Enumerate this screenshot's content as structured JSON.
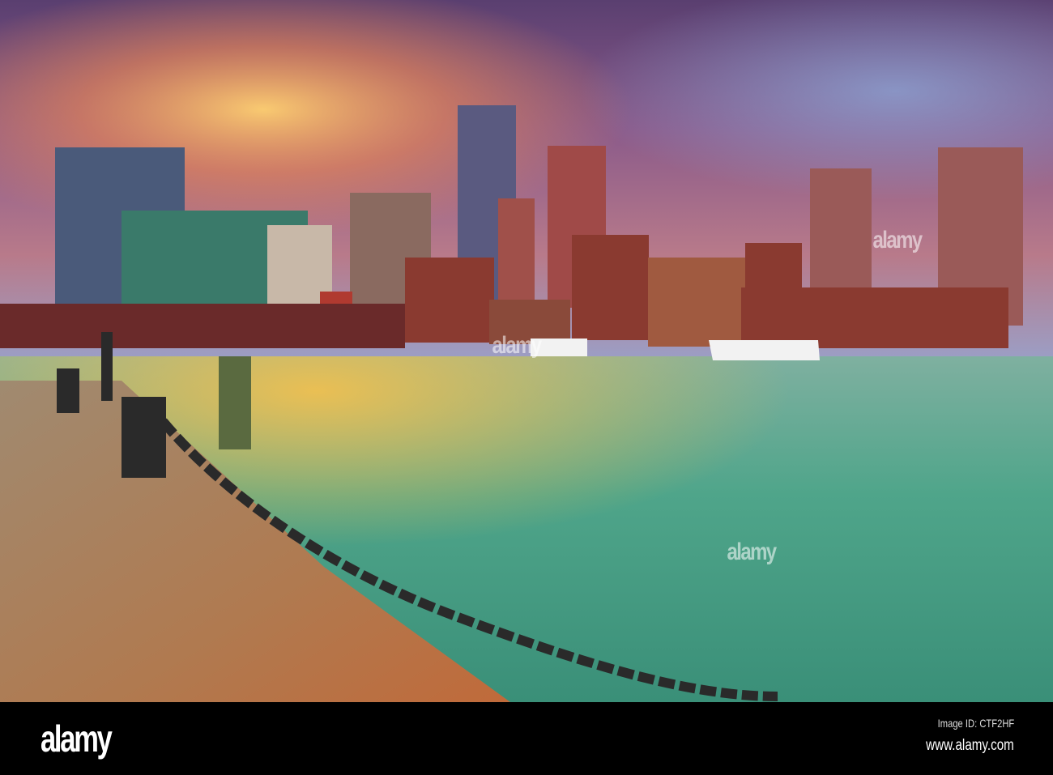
{
  "photo": {
    "subject": "harbor skyline at sunset",
    "watermark_text": "alamy"
  },
  "footer": {
    "logo": "alamy",
    "image_id": "Image ID: CTF2HF",
    "website": "www.alamy.com"
  },
  "colors": {
    "sky_top": "#6a4f8c",
    "sky_glow": "#f0a050",
    "water": "#4fa58a",
    "buildings": "#8a3a30"
  }
}
